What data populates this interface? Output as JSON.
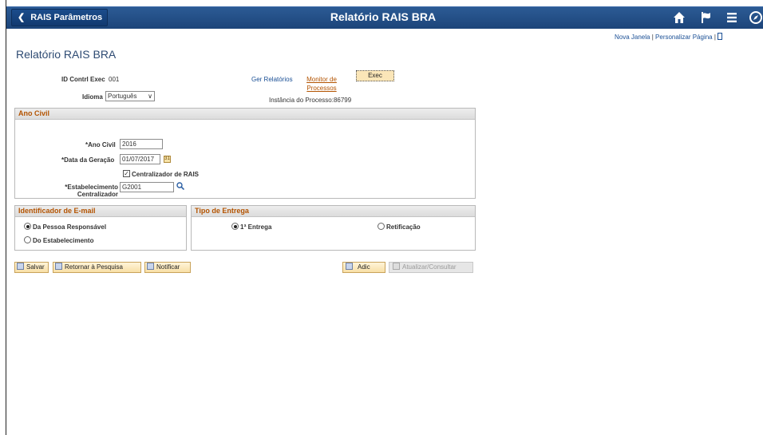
{
  "header": {
    "back_label": "RAIS Parâmetros",
    "app_title": "Relatório RAIS BRA",
    "icons": [
      "home-icon",
      "flag-icon",
      "menu-icon",
      "navbar-icon"
    ]
  },
  "links": {
    "new_window": "Nova Janela",
    "separator": "|",
    "personalize": "Personalizar Página"
  },
  "page": {
    "title": "Relatório RAIS BRA"
  },
  "run_control": {
    "id_label": "ID Contrl Exec",
    "id_value": "001",
    "language_label": "Idioma",
    "language_value": "Português",
    "report_manager": "Ger Relatórios",
    "process_monitor": "Monitor de Processos",
    "exec_button": "Exec",
    "process_instance_label": "Instância do Processo:",
    "process_instance_value": "86799"
  },
  "ano_civil_group": {
    "title": "Ano Civil",
    "year_label": "*Ano Civil",
    "year_value": "2016",
    "date_label": "*Data da Geração",
    "date_value": "01/07/2017",
    "centralizer_label": "Centralizador de RAIS",
    "centralizer_checked": true,
    "establishment_label_1": "*Estabelecimento",
    "establishment_label_2": "Centralizador",
    "establishment_value": "G2001"
  },
  "email_group": {
    "title": "Identificador de E-mail",
    "options": [
      {
        "label": "Da Pessoa Responsável",
        "selected": true
      },
      {
        "label": "Do Estabelecimento",
        "selected": false
      }
    ]
  },
  "delivery_group": {
    "title": "Tipo de Entrega",
    "options": [
      {
        "label": "1ª Entrega",
        "selected": true
      },
      {
        "label": "Retificação",
        "selected": false
      }
    ]
  },
  "toolbar": {
    "save": "Salvar",
    "return_to_search": "Retornar à Pesquisa",
    "notify": "Notificar",
    "add": "Adic",
    "update_display": "Atualizar/Consultar"
  },
  "colors": {
    "header_bg": "#1c4479",
    "group_title": "#b35300",
    "link": "#1a4f95"
  }
}
